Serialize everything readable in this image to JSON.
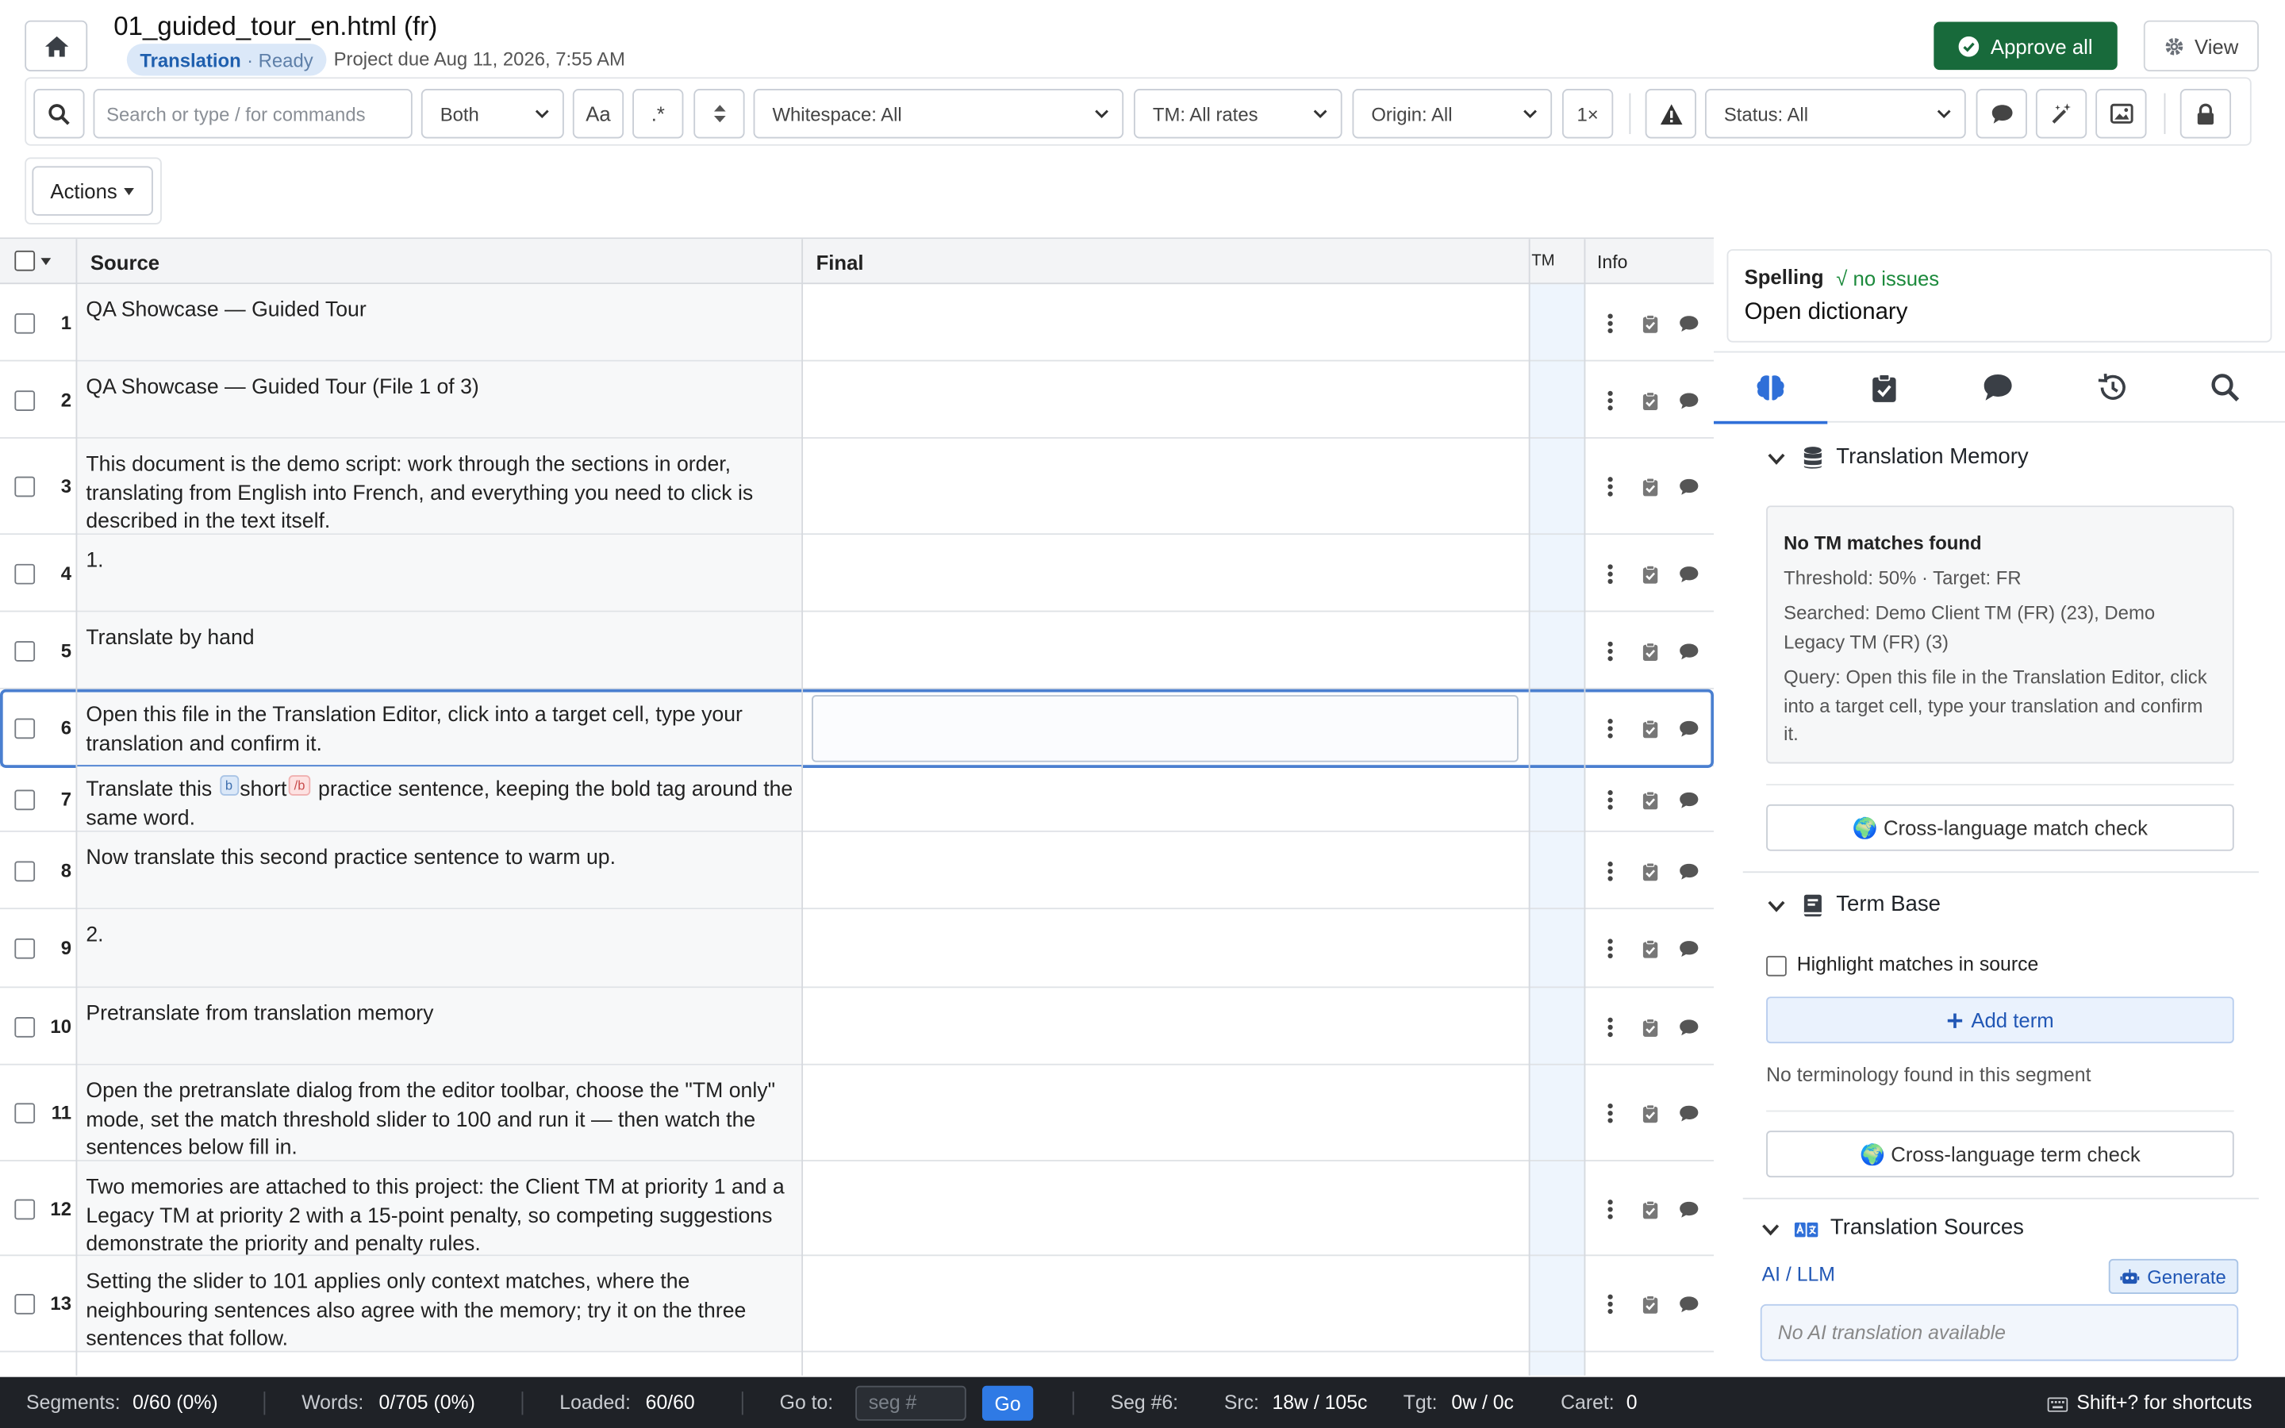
{
  "header": {
    "file_title": "01_guided_tour_en.html (fr)",
    "badge_step": "Translation",
    "badge_state": "· Ready",
    "due": "Project due Aug 11, 2026, 7:55 AM",
    "approve_all": "Approve all",
    "view": "View"
  },
  "toolbar": {
    "search_placeholder": "Search or type / for commands",
    "scope": "Both",
    "case_label": "Aa",
    "regex_label": ".*",
    "whitespace": "Whitespace: All",
    "tm_rates": "TM: All rates",
    "origin": "Origin: All",
    "repeat_label": "1×",
    "status": "Status: All",
    "actions": "Actions"
  },
  "grid": {
    "col_source": "Source",
    "col_final": "Final",
    "col_tm": "TM",
    "col_info": "Info",
    "rows": [
      {
        "num": "1",
        "source": "QA Showcase — Guided Tour"
      },
      {
        "num": "2",
        "source": "QA Showcase — Guided Tour (File 1 of 3)"
      },
      {
        "num": "3",
        "source": "This document is the demo script: work through the sections in order, translating from English into French, and everything you need to click is described in the text itself."
      },
      {
        "num": "4",
        "source": "1."
      },
      {
        "num": "5",
        "source": "Translate by hand"
      },
      {
        "num": "6",
        "source": "Open this file in the Translation Editor, click into a target cell, type your translation and confirm it."
      },
      {
        "num": "7",
        "source_before": "Translate this",
        "tag_open": "b",
        "source_tagged": "short",
        "tag_close": "/b",
        "source_after": "practice sentence, keeping the bold tag around the same word."
      },
      {
        "num": "8",
        "source": "Now translate this second practice sentence to warm up."
      },
      {
        "num": "9",
        "source": "2."
      },
      {
        "num": "10",
        "source": "Pretranslate from translation memory"
      },
      {
        "num": "11",
        "source": "Open the pretranslate dialog from the editor toolbar, choose the \"TM only\" mode, set the match threshold slider to 100 and run it — then watch the sentences below fill in."
      },
      {
        "num": "12",
        "source": "Two memories are attached to this project: the Client TM at priority 1 and a Legacy TM at priority 2 with a 15-point penalty, so competing suggestions demonstrate the priority and penalty rules."
      },
      {
        "num": "13",
        "source": "Setting the slider to 101 applies only context matches, where the neighbouring sentences also agree with the memory; try it on the three sentences that follow."
      }
    ]
  },
  "spelling": {
    "title": "Spelling",
    "status": "√ no issues",
    "open_dictionary": "Open dictionary"
  },
  "panel": {
    "tm": {
      "title": "Translation Memory",
      "no_matches": "No TM matches found",
      "threshold": "Threshold: 50% · Target: FR",
      "searched": "Searched: Demo Client TM (FR) (23), Demo Legacy TM (FR) (3)",
      "query": "Query: Open this file in the Translation Editor, click into a target cell, type your translation and confirm it.",
      "cross_check": "🌍 Cross-language match check"
    },
    "termbase": {
      "title": "Term Base",
      "highlight": "Highlight matches in source",
      "add_term": "Add term",
      "none": "No terminology found in this segment",
      "cross_check": "🌍 Cross-language term check"
    },
    "sources": {
      "title": "Translation Sources",
      "ai_label": "AI / LLM",
      "generate": "Generate",
      "no_ai": "No AI translation available"
    }
  },
  "statusbar": {
    "segments_label": "Segments:",
    "segments": "0/60 (0%)",
    "words_label": "Words:",
    "words": "0/705 (0%)",
    "loaded_label": "Loaded:",
    "loaded": "60/60",
    "goto_label": "Go to:",
    "goto_placeholder": "seg #",
    "go": "Go",
    "seg_label": "Seg #6:",
    "src_label": "Src:",
    "src": "18w / 105c",
    "tgt_label": "Tgt:",
    "tgt": "0w / 0c",
    "caret_label": "Caret:",
    "caret": "0",
    "shortcuts": "Shift+? for shortcuts"
  },
  "colors": {
    "accent": "#2f6fd8",
    "approve_green": "#186a3b",
    "ok_green": "#1c8a3c"
  }
}
